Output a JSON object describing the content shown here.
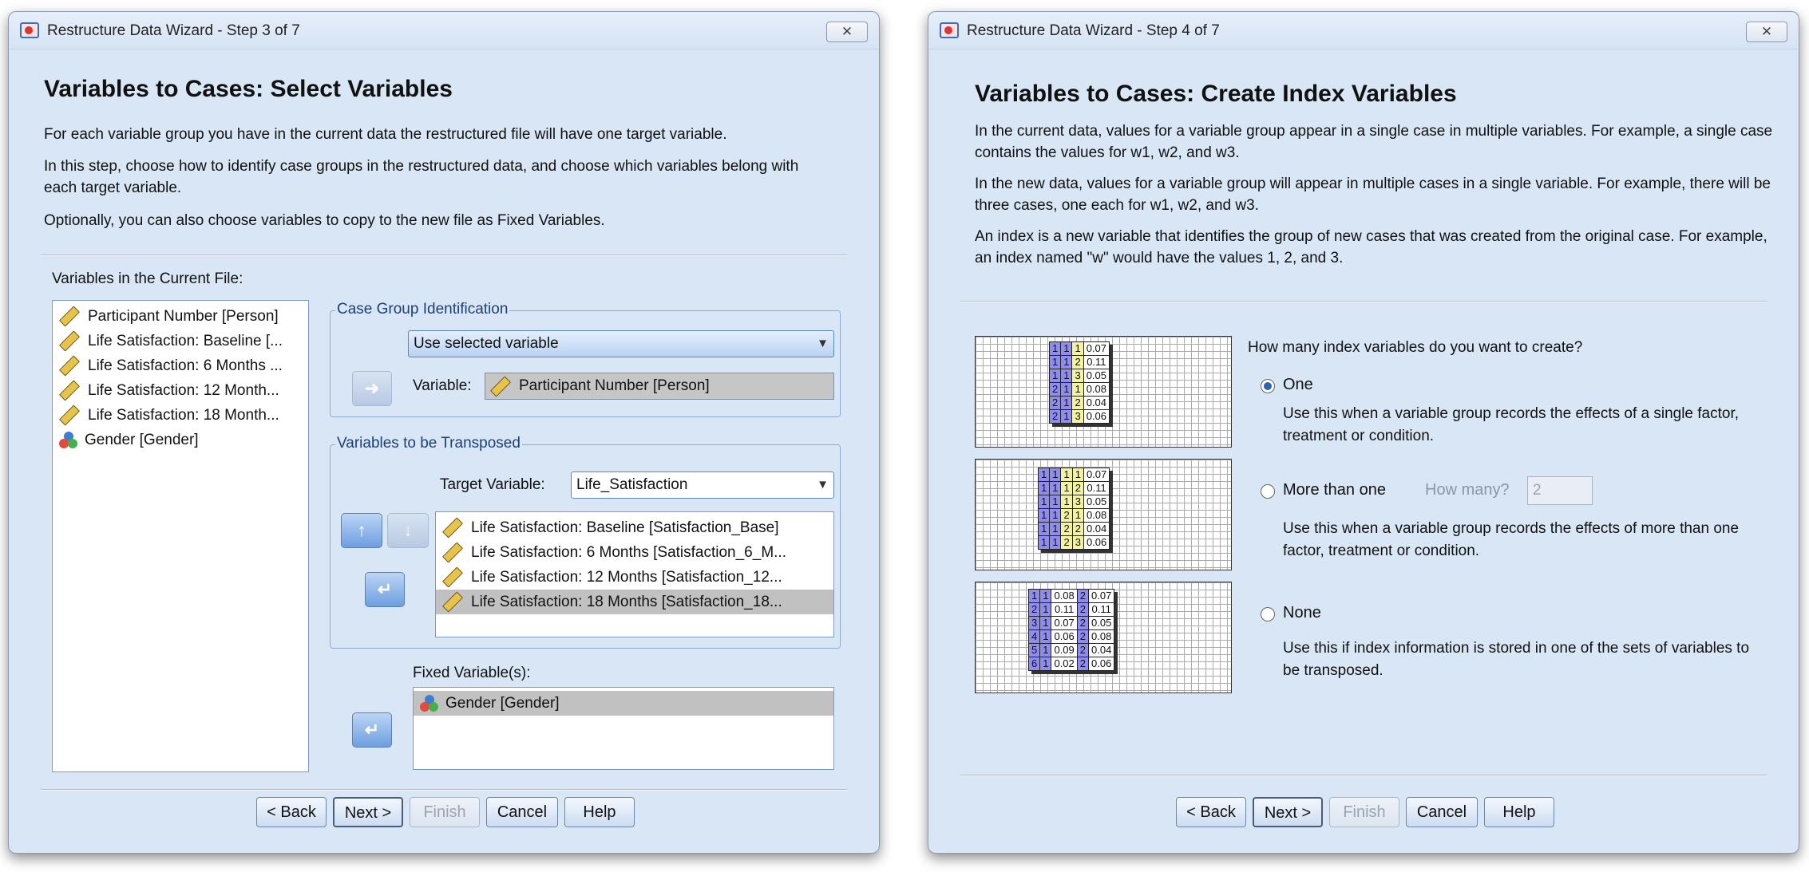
{
  "left_window": {
    "title": "Restructure Data Wizard - Step 3 of 7",
    "heading": "Variables to Cases: Select Variables",
    "para1": "For each variable group you have in the current data the restructured file will have one target variable.",
    "para2": "In this step, choose how to identify case groups in the restructured data, and choose which variables belong with each target variable.",
    "para3": "Optionally, you can also choose variables to copy to the new file as Fixed Variables.",
    "vars_label": "Variables in the Current File:",
    "vars_list": [
      {
        "label": "Participant Number [Person]",
        "icon": "scale-ruler-icon"
      },
      {
        "label": "Life Satisfaction: Baseline [...",
        "icon": "scale-ruler-icon"
      },
      {
        "label": "Life Satisfaction: 6 Months ...",
        "icon": "scale-ruler-icon"
      },
      {
        "label": "Life Satisfaction: 12 Month...",
        "icon": "scale-ruler-icon"
      },
      {
        "label": "Life Satisfaction: 18 Month...",
        "icon": "scale-ruler-icon"
      },
      {
        "label": "Gender [Gender]",
        "icon": "nominal-circles-icon"
      }
    ],
    "case_group": {
      "title": "Case Group Identification",
      "method": "Use selected variable",
      "variable_label": "Variable:",
      "variable_value": "Participant Number [Person]"
    },
    "transposed": {
      "title": "Variables to be Transposed",
      "target_label": "Target Variable:",
      "target_value": "Life_Satisfaction",
      "items": [
        "Life Satisfaction: Baseline [Satisfaction_Base]",
        "Life Satisfaction: 6 Months [Satisfaction_6_M...",
        "Life Satisfaction: 12 Months [Satisfaction_12...",
        "Life Satisfaction: 18 Months [Satisfaction_18..."
      ]
    },
    "fixed": {
      "label": "Fixed Variable(s):",
      "items": [
        "Gender [Gender]"
      ]
    },
    "buttons": {
      "back": "< Back",
      "next": "Next >",
      "finish": "Finish",
      "cancel": "Cancel",
      "help": "Help"
    },
    "close": "✕"
  },
  "right_window": {
    "title": "Restructure Data Wizard - Step 4 of 7",
    "heading": "Variables to Cases: Create Index Variables",
    "para1": "In the current data, values for a variable group appear in a single case in multiple variables.  For example, a single case contains the values for w1, w2, and w3.",
    "para2": "In the new data, values for a variable group will appear in multiple cases in a single variable.  For example, there will be three cases, one each for w1, w2, and w3.",
    "para3": "An index is a new variable that identifies the group of new cases that was created from the original case. For example, an index named \"w\" would have the values 1, 2, and 3.",
    "question": "How many index variables do you want to create?",
    "options": {
      "one": {
        "label": "One",
        "desc": "Use this when a variable group records the effects of a single factor, treatment or condition.",
        "selected": true
      },
      "more": {
        "label": "More than one",
        "desc": "Use this when a variable group records the effects of more than one factor, treatment or condition.",
        "selected": false,
        "how_many_label": "How many?",
        "how_many_value": "2"
      },
      "none": {
        "label": "None",
        "desc": "Use this if index information is stored in one of the sets of variables to be transposed.",
        "selected": false
      }
    },
    "diagram1": [
      [
        "1",
        "1",
        "1",
        "0.07"
      ],
      [
        "1",
        "1",
        "2",
        "0.11"
      ],
      [
        "1",
        "1",
        "3",
        "0.05"
      ],
      [
        "2",
        "1",
        "1",
        "0.08"
      ],
      [
        "2",
        "1",
        "2",
        "0.04"
      ],
      [
        "2",
        "1",
        "3",
        "0.06"
      ]
    ],
    "diagram2": [
      [
        "1",
        "1",
        "1",
        "1",
        "0.07"
      ],
      [
        "1",
        "1",
        "1",
        "2",
        "0.11"
      ],
      [
        "1",
        "1",
        "1",
        "3",
        "0.05"
      ],
      [
        "1",
        "1",
        "2",
        "1",
        "0.08"
      ],
      [
        "1",
        "1",
        "2",
        "2",
        "0.04"
      ],
      [
        "1",
        "1",
        "2",
        "3",
        "0.06"
      ]
    ],
    "diagram3": [
      [
        "1",
        "1",
        "0.08",
        "2",
        "0.07"
      ],
      [
        "2",
        "1",
        "0.11",
        "2",
        "0.11"
      ],
      [
        "3",
        "1",
        "0.07",
        "2",
        "0.05"
      ],
      [
        "4",
        "1",
        "0.06",
        "2",
        "0.08"
      ],
      [
        "5",
        "1",
        "0.09",
        "2",
        "0.04"
      ],
      [
        "6",
        "1",
        "0.02",
        "2",
        "0.06"
      ]
    ],
    "buttons": {
      "back": "< Back",
      "next": "Next >",
      "finish": "Finish",
      "cancel": "Cancel",
      "help": "Help"
    },
    "close": "✕"
  }
}
